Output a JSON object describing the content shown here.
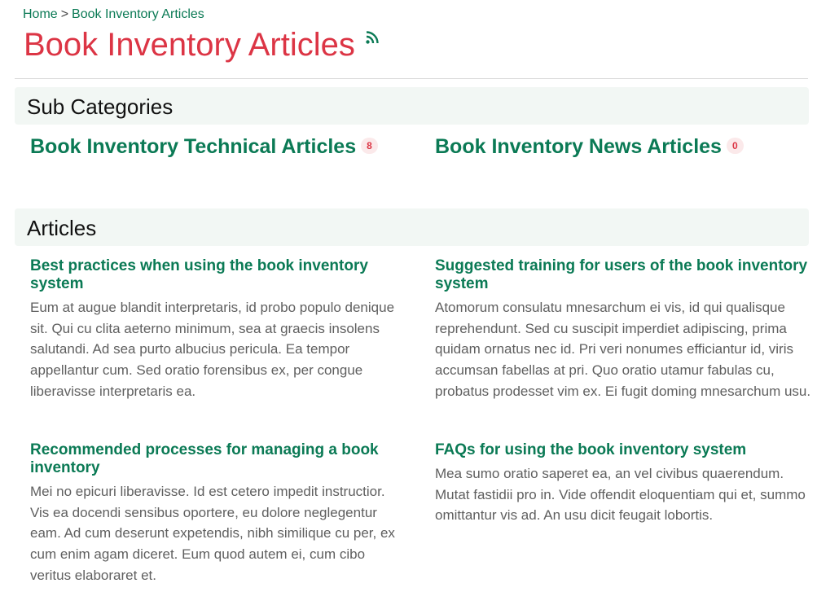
{
  "breadcrumb": {
    "home": "Home",
    "separator": ">",
    "current": "Book Inventory Articles"
  },
  "page_title": "Book Inventory Articles",
  "rss_icon": "rss-feed-icon",
  "sub_categories": {
    "heading": "Sub Categories",
    "items": [
      {
        "label": "Book Inventory Technical Articles",
        "count": "8"
      },
      {
        "label": "Book Inventory News Articles",
        "count": "0"
      }
    ]
  },
  "articles": {
    "heading": "Articles",
    "items": [
      {
        "title": "Best practices when using the book inventory system",
        "summary": "Eum at augue blandit interpretaris, id probo populo denique sit. Qui cu clita aeterno minimum, sea at graecis insolens salutandi. Ad sea purto albucius pericula. Ea tempor appellantur cum. Sed oratio forensibus ex, per congue liberavisse interpretaris ea."
      },
      {
        "title": "Suggested training for users of the book inventory system",
        "summary": "Atomorum consulatu mnesarchum ei vis, id qui qualisque reprehendunt. Sed cu suscipit imperdiet adipiscing, prima quidam ornatus nec id. Pri veri nonumes efficiantur id, viris accumsan fabellas at pri. Quo oratio utamur fabulas cu, probatus prodesset vim ex. Ei fugit doming mnesarchum usu."
      },
      {
        "title": "Recommended processes for managing a book inventory",
        "summary": "Mei no epicuri liberavisse. Id est cetero impedit instructior. Vis ea docendi sensibus oportere, eu dolore neglegentur eam. Ad cum deserunt expetendis, nibh similique cu per, ex cum enim agam diceret. Eum quod autem ei, cum cibo veritus elaboraret et."
      },
      {
        "title": "FAQs for using the book inventory system",
        "summary": "Mea sumo oratio saperet ea, an vel civibus quaerendum. Mutat fastidii pro in. Vide offendit eloquentiam qui et, summo omittantur vis ad. An usu dicit feugait lobortis."
      }
    ]
  },
  "colors": {
    "accent_green": "#0b7a55",
    "title_red": "#dc3545",
    "section_bg": "#f2f7f4"
  }
}
